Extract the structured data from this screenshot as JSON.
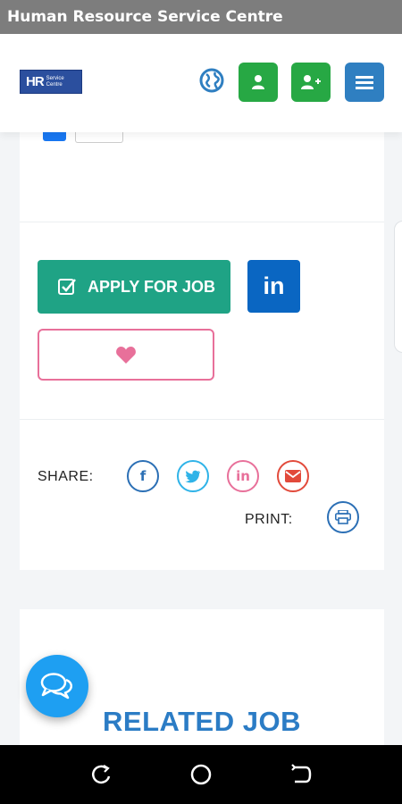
{
  "window": {
    "title": "Human Resource Service Centre"
  },
  "header": {
    "logo": {
      "mark": "HR",
      "line1": "Service",
      "line2": "Centre"
    },
    "icons": [
      "globe-icon",
      "user-icon",
      "user-plus-icon",
      "hamburger-icon"
    ]
  },
  "actions": {
    "apply_label": "APPLY FOR JOB",
    "linkedin_label": "in"
  },
  "share": {
    "label": "SHARE:",
    "buttons": [
      {
        "name": "facebook",
        "glyph": "f"
      },
      {
        "name": "twitter",
        "glyph": "twitter"
      },
      {
        "name": "linkedin",
        "glyph": "in"
      },
      {
        "name": "email",
        "glyph": "envelope"
      }
    ],
    "print_label": "PRINT:"
  },
  "related": {
    "title": "RELATED JOB"
  },
  "colors": {
    "apply": "#1fa385",
    "linkedin": "#0a66c2",
    "favorite": "#e8709a",
    "header_green": "#27a844",
    "menu_blue": "#2f7fc1",
    "related_title": "#2b7cc5",
    "chat": "#1e9ff2"
  }
}
